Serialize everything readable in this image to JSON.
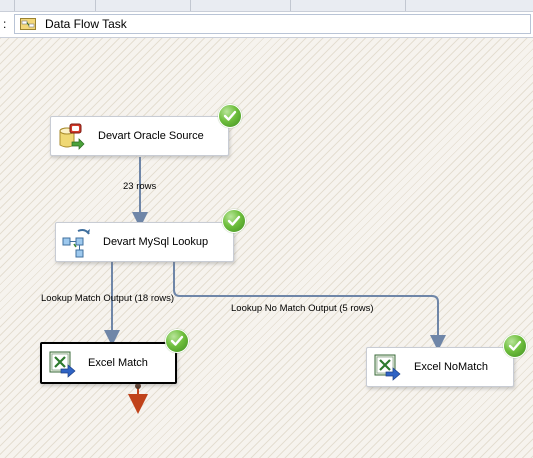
{
  "task_bar": {
    "prefix": ":",
    "current_task": "Data Flow Task",
    "icon": "data-flow-task-icon"
  },
  "components": {
    "oracle_source": {
      "label": "Devart Oracle Source",
      "icon": "database-source-icon",
      "status": "ok"
    },
    "mysql_lookup": {
      "label": "Devart MySql Lookup",
      "icon": "lookup-transform-icon",
      "status": "ok"
    },
    "excel_match": {
      "label": "Excel Match",
      "icon": "excel-destination-icon",
      "status": "ok",
      "selected": true
    },
    "excel_nomatch": {
      "label": "Excel NoMatch",
      "icon": "excel-destination-icon",
      "status": "ok"
    }
  },
  "paths": {
    "source_to_lookup": "23 rows",
    "match_output": "Lookup Match Output (18 rows)",
    "nomatch_output": "Lookup No Match Output (5 rows)"
  },
  "colors": {
    "path_line": "#6f86a8",
    "error_output": "#c0421a",
    "status_ok": "#5aad2e"
  }
}
